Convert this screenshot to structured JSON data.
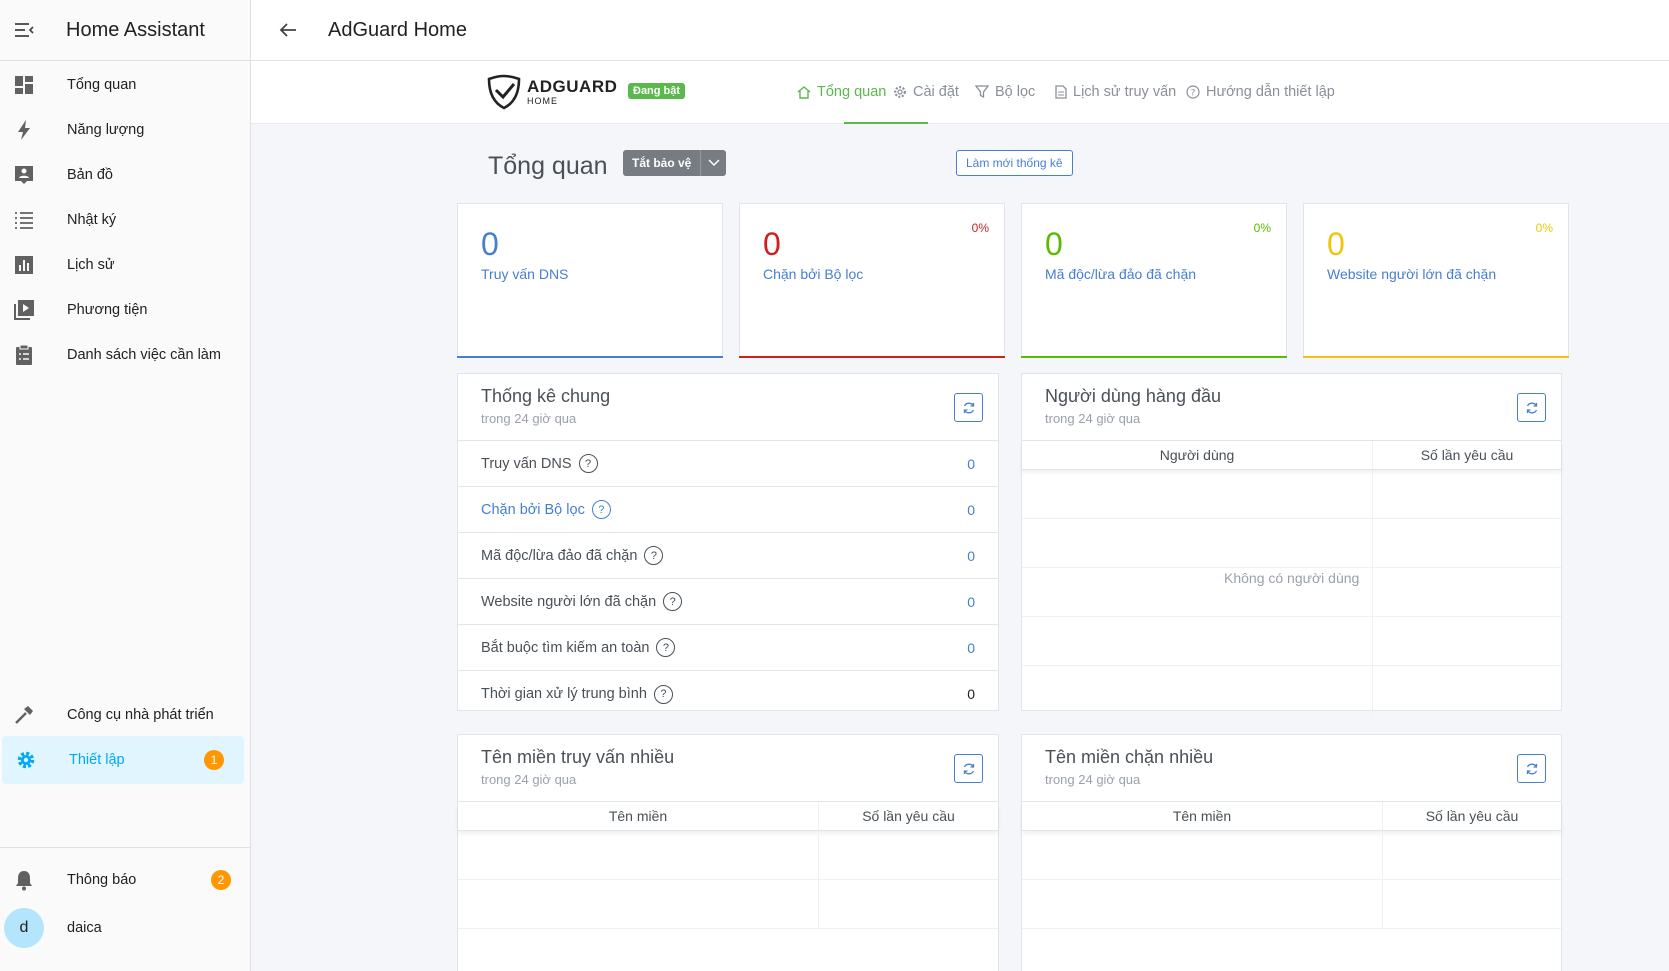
{
  "sidebar": {
    "app_title": "Home Assistant",
    "items": [
      {
        "label": "Tổng quan",
        "icon": "dashboard-icon"
      },
      {
        "label": "Năng lượng",
        "icon": "lightning-icon"
      },
      {
        "label": "Bản đồ",
        "icon": "map-icon"
      },
      {
        "label": "Nhật ký",
        "icon": "logbook-icon"
      },
      {
        "label": "Lịch sử",
        "icon": "chart-icon"
      },
      {
        "label": "Phương tiện",
        "icon": "media-icon"
      },
      {
        "label": "Danh sách việc cần làm",
        "icon": "clipboard-icon"
      }
    ],
    "dev_tools": {
      "label": "Công cụ nhà phát triển",
      "icon": "hammer-icon"
    },
    "settings": {
      "label": "Thiết lập",
      "icon": "gear-icon",
      "badge": "1"
    },
    "notifications": {
      "label": "Thông báo",
      "icon": "bell-icon",
      "badge": "2"
    },
    "user": {
      "initial": "d",
      "name": "daica"
    }
  },
  "topbar": {
    "title": "AdGuard Home"
  },
  "adguard": {
    "logo_text": "ADGUARD",
    "logo_sub": "HOME",
    "status": "Đang bật",
    "nav": [
      {
        "label": "Tổng quan",
        "icon": "home-icon"
      },
      {
        "label": "Cài đặt",
        "icon": "gear-icon"
      },
      {
        "label": "Bộ lọc",
        "icon": "filter-icon"
      },
      {
        "label": "Lịch sử truy vấn",
        "icon": "document-icon"
      },
      {
        "label": "Hướng dẫn thiết lập",
        "icon": "help-icon"
      }
    ],
    "page_title": "Tổng quan",
    "disable_btn": "Tắt bảo vệ",
    "refresh_stats_btn": "Làm mới thống kê",
    "stat_cards": [
      {
        "value": "0",
        "label": "Truy vấn DNS",
        "percent": "",
        "color": "#467fcf"
      },
      {
        "value": "0",
        "label": "Chặn bởi Bộ lọc",
        "percent": "0%",
        "color": "#cd201f"
      },
      {
        "value": "0",
        "label": "Mã độc/lừa đảo đã chặn",
        "percent": "0%",
        "color": "#5eba00"
      },
      {
        "value": "0",
        "label": "Website người lớn đã chặn",
        "percent": "0%",
        "color": "#f1c40f"
      }
    ],
    "general_stats": {
      "title": "Thống kê chung",
      "subtitle": "trong 24 giờ qua",
      "rows": [
        {
          "name": "Truy vấn DNS",
          "value": "0"
        },
        {
          "name": "Chặn bởi Bộ lọc",
          "value": "0"
        },
        {
          "name": "Mã độc/lừa đảo đã chặn",
          "value": "0"
        },
        {
          "name": "Website người lớn đã chặn",
          "value": "0"
        },
        {
          "name": "Bắt buộc tìm kiếm an toàn",
          "value": "0"
        },
        {
          "name": "Thời gian xử lý trung bình",
          "value": "0"
        }
      ]
    },
    "top_clients": {
      "title": "Người dùng hàng đầu",
      "subtitle": "trong 24 giờ qua",
      "col1": "Người dùng",
      "col2": "Số lần yêu cầu",
      "empty": "Không có người dùng"
    },
    "top_queried": {
      "title": "Tên miền truy vấn nhiều",
      "subtitle": "trong 24 giờ qua",
      "col1": "Tên miền",
      "col2": "Số lần yêu cầu"
    },
    "top_blocked": {
      "title": "Tên miền chặn nhiều",
      "subtitle": "trong 24 giờ qua",
      "col1": "Tên miền",
      "col2": "Số lần yêu cầu"
    }
  },
  "colors": {
    "ha_accent": "#03a9f4",
    "badge": "#ff9800",
    "adguard_green": "#5ab84c",
    "link_blue": "#467fcf"
  }
}
